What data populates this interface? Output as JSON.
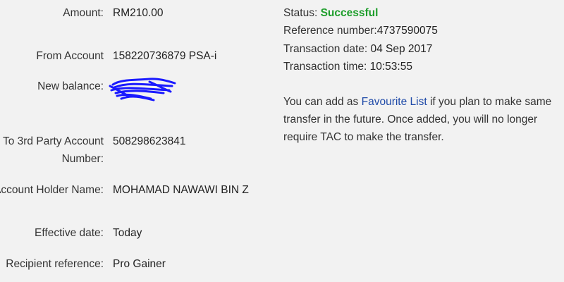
{
  "left": {
    "amount": {
      "label": "Amount:",
      "value": "RM210.00"
    },
    "from_account": {
      "label": "From Account",
      "value": "158220736879 PSA-i"
    },
    "new_balance": {
      "label": "New balance:"
    },
    "to_account": {
      "label": "To 3rd Party Account Number:",
      "value": "508298623841"
    },
    "holder": {
      "label": "Account Holder Name:",
      "value": "MOHAMAD NAWAWI BIN Z"
    },
    "effective": {
      "label": "Effective date:",
      "value": "Today"
    },
    "recipient_ref": {
      "label": "Recipient reference:",
      "value": "Pro Gainer"
    }
  },
  "right": {
    "status": {
      "label": "Status:",
      "value": "Successful"
    },
    "reference": {
      "label": "Reference number:",
      "value": "4737590075"
    },
    "date": {
      "label": "Transaction date:",
      "value": "04 Sep 2017"
    },
    "time": {
      "label": "Transaction time:",
      "value": "10:53:55"
    },
    "note": {
      "before": "You can add as ",
      "link": "Favourite List",
      "after": " if you plan to make same transfer in the future. Once added, you will no longer require TAC to make the transfer."
    }
  },
  "colors": {
    "status_success": "#1e9e2b",
    "link": "#1f4aa8",
    "scribble": "#1a1aff"
  }
}
